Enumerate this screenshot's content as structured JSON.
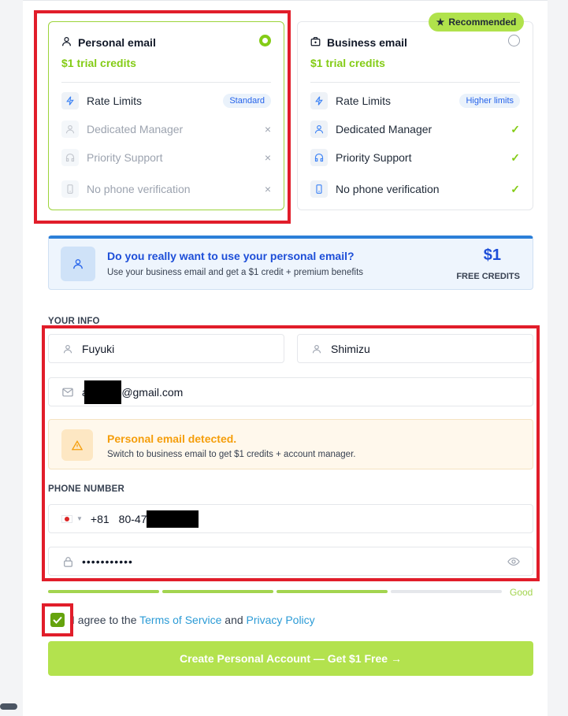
{
  "plans": {
    "personal": {
      "title": "Personal email",
      "credit": "$1 trial credits",
      "selected": true,
      "features": [
        {
          "icon": "lightning-icon",
          "label": "Rate Limits",
          "value": "Standard"
        },
        {
          "icon": "user-icon",
          "label": "Dedicated Manager",
          "value": "×"
        },
        {
          "icon": "headphones-icon",
          "label": "Priority Support",
          "value": "×"
        },
        {
          "icon": "phone-icon",
          "label": "No phone verification",
          "value": "×"
        }
      ]
    },
    "business": {
      "badge": "Recommended",
      "title": "Business email",
      "credit": "$1 trial credits",
      "selected": false,
      "features": [
        {
          "icon": "lightning-icon",
          "label": "Rate Limits",
          "value": "Higher limits"
        },
        {
          "icon": "user-icon",
          "label": "Dedicated Manager",
          "value": "✓"
        },
        {
          "icon": "headphones-icon",
          "label": "Priority Support",
          "value": "✓"
        },
        {
          "icon": "phone-icon",
          "label": "No phone verification",
          "value": "✓"
        }
      ]
    }
  },
  "banner": {
    "title": "Do you really want to use your personal email?",
    "subtitle": "Use your business email and get a $1 credit + premium benefits",
    "amount": "$1",
    "caption": "FREE CREDITS"
  },
  "your_info": {
    "label": "YOUR INFO",
    "first_name": "Fuyuki",
    "last_name": "Shimizu",
    "email_prefix": "aff",
    "email_suffix": "@gmail.com"
  },
  "warning": {
    "title": "Personal email detected.",
    "subtitle": "Switch to business email to get $1 credits + account manager."
  },
  "phone": {
    "label": "PHONE NUMBER",
    "dial_code": "+81",
    "number_prefix": "80-47"
  },
  "password": {
    "value": "•••••••••••",
    "strength_label": "Good",
    "strength_segments_filled": 3,
    "strength_segments_total": 4
  },
  "agree": {
    "checked": true,
    "prefix": "I agree to the ",
    "terms": "Terms of Service",
    "and": " and ",
    "privacy": "Privacy Policy"
  },
  "submit": {
    "label": "Create Personal Account — Get $1 Free →"
  },
  "colors": {
    "accent_green": "#84cc16",
    "button_green": "#b3e24e",
    "link_blue": "#2b9bd6",
    "banner_blue": "#1d4ed8",
    "warning_orange": "#f59e0b",
    "highlight_red": "#e11d2a"
  }
}
